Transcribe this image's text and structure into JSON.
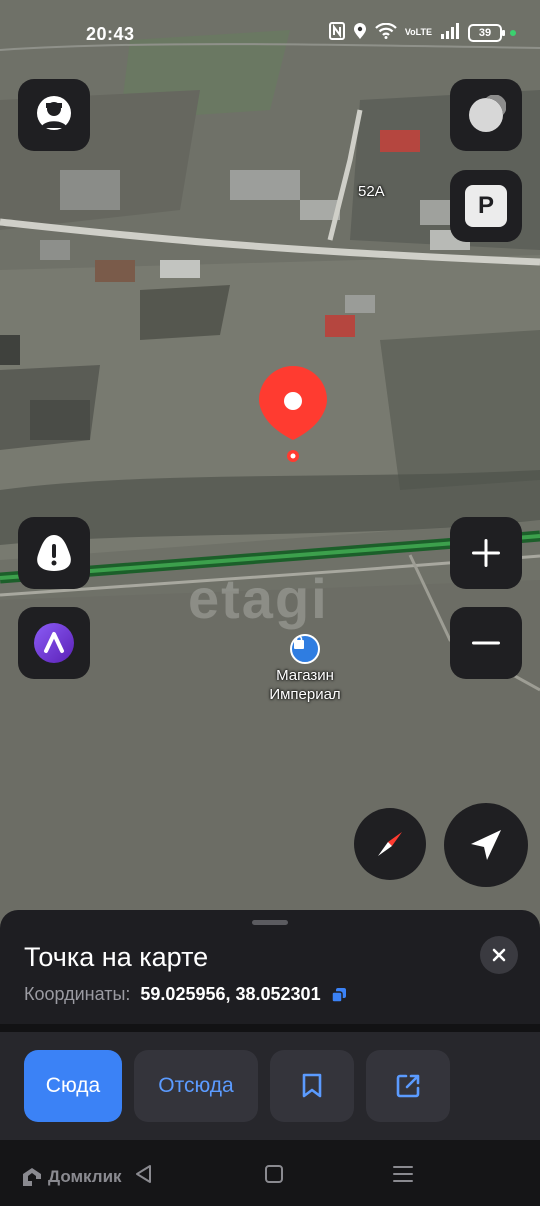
{
  "status_bar": {
    "time": "20:43",
    "network": "VoLTE",
    "battery": "39",
    "icons": [
      "nfc-icon",
      "location-icon",
      "wifi-icon",
      "signal-icon",
      "battery-icon"
    ]
  },
  "map": {
    "building_label": "52A",
    "watermark": "etagi",
    "poi": {
      "name_line1": "Магазин",
      "name_line2": "Империал",
      "icon": "shop-icon"
    },
    "controls": [
      "profile-icon",
      "layers-icon",
      "parking-icon",
      "alert-icon",
      "alice-icon",
      "zoom-in-icon",
      "zoom-out-icon",
      "compass-icon",
      "locate-icon"
    ],
    "colors": {
      "pin": "#ff3b30",
      "road_green": "#2e8b3e",
      "control_bg": "#1f1f22"
    }
  },
  "sheet": {
    "title": "Точка на карте",
    "coords_label": "Координаты:",
    "coords_value": "59.025956, 38.052301",
    "actions": {
      "here": "Сюда",
      "from": "Отсюда"
    },
    "colors": {
      "primary": "#3b82f6",
      "link": "#5b9bff"
    }
  },
  "navbar": {
    "brand": "Домклик"
  }
}
